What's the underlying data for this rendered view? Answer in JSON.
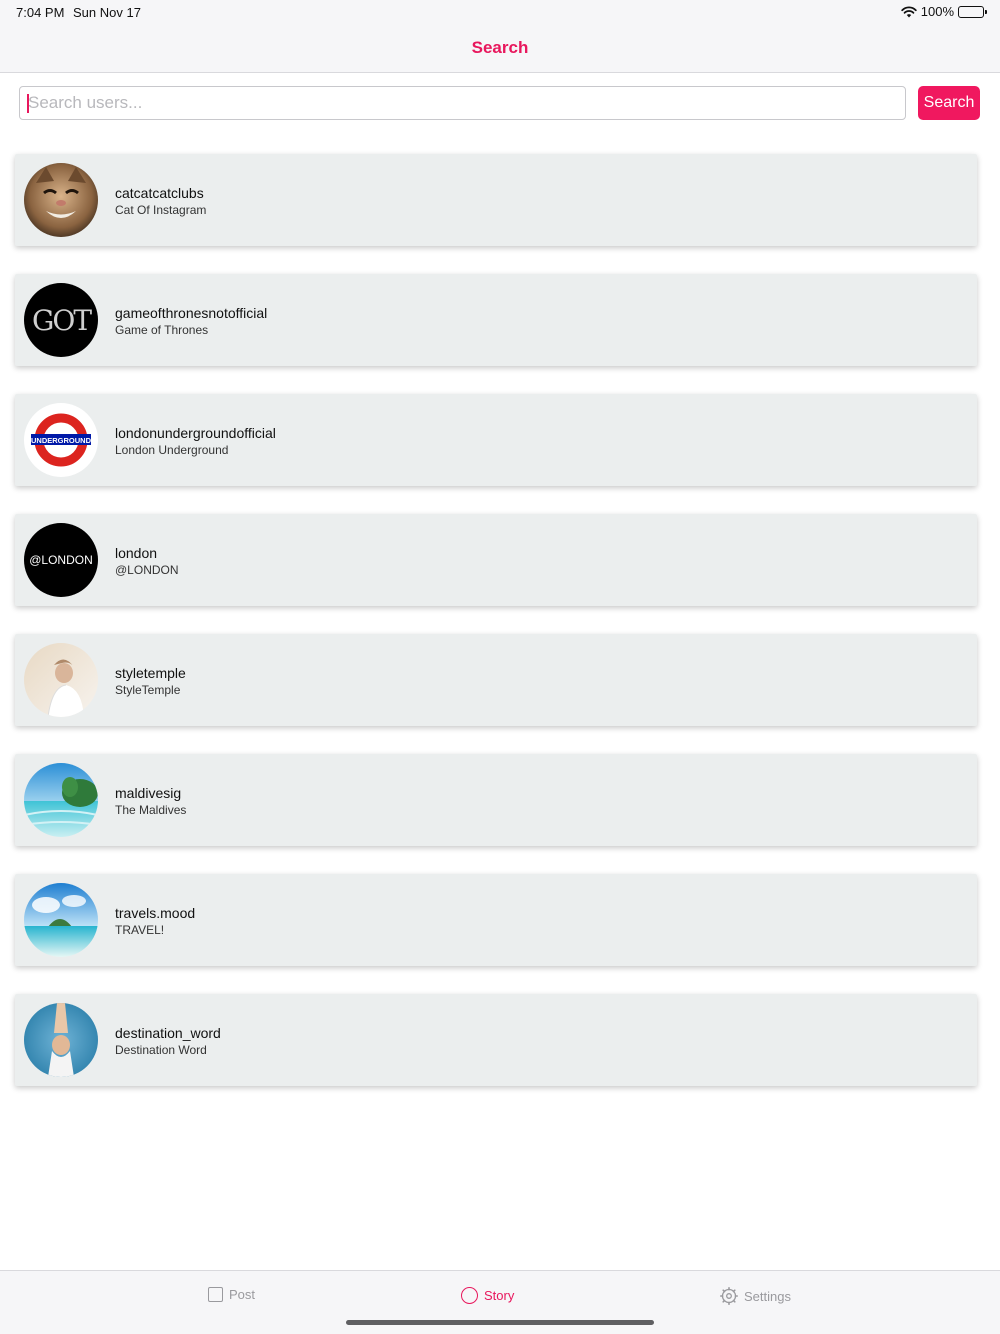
{
  "status_bar": {
    "time": "7:04 PM",
    "date": "Sun Nov 17",
    "battery": "100%"
  },
  "nav": {
    "title": "Search"
  },
  "search": {
    "placeholder": "Search users...",
    "value": "",
    "button_label": "Search"
  },
  "users": [
    {
      "username": "catcatcatclubs",
      "name": "Cat Of Instagram",
      "avatar": "cat-photo"
    },
    {
      "username": "gameofthronesnotofficial",
      "name": "Game of Thrones",
      "avatar": "got-logo",
      "avatar_text": "GOT"
    },
    {
      "username": "londonundergroundofficial",
      "name": "London Underground",
      "avatar": "underground-roundel",
      "avatar_text": "UNDERGROUND"
    },
    {
      "username": "london",
      "name": "@LONDON",
      "avatar": "london-logo",
      "avatar_text": "@LONDON"
    },
    {
      "username": "styletemple",
      "name": "StyleTemple",
      "avatar": "fashion-photo"
    },
    {
      "username": "maldivesig",
      "name": "The Maldives",
      "avatar": "beach-photo"
    },
    {
      "username": "travels.mood",
      "name": "TRAVEL!",
      "avatar": "island-photo"
    },
    {
      "username": "destination_word",
      "name": "Destination Word",
      "avatar": "person-photo"
    }
  ],
  "tabs": [
    {
      "label": "Post",
      "icon": "square-icon",
      "active": false
    },
    {
      "label": "Story",
      "icon": "circle-icon",
      "active": true
    },
    {
      "label": "Settings",
      "icon": "gear-icon",
      "active": false
    }
  ],
  "colors": {
    "accent": "#e8175d",
    "card": "#ebeeee",
    "inactive": "#9a9a9e"
  }
}
